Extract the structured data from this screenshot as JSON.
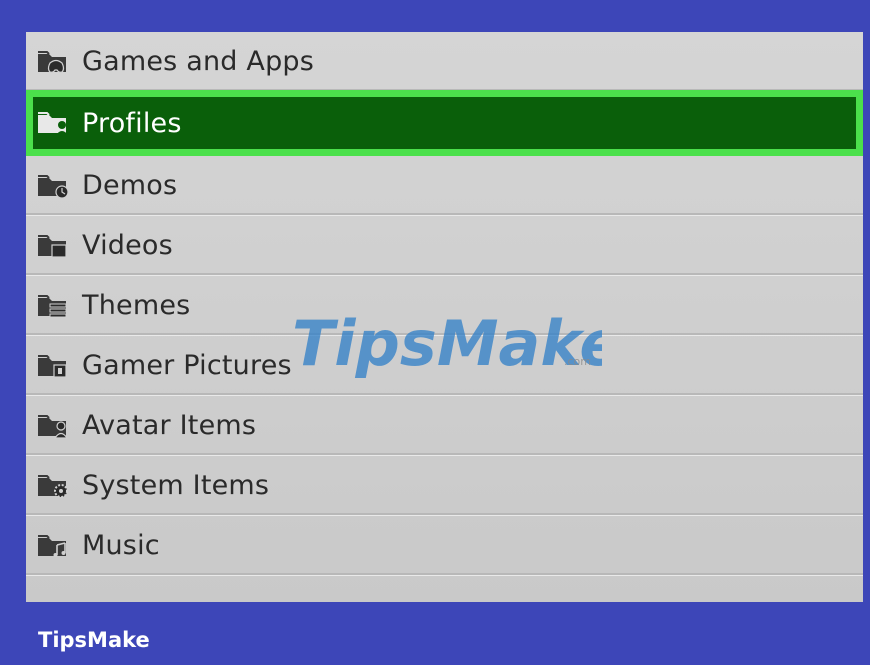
{
  "menu": {
    "items": [
      {
        "label": "Games and Apps",
        "icon": "folder-gamepad-icon",
        "selected": false
      },
      {
        "label": "Profiles",
        "icon": "folder-profile-icon",
        "selected": true
      },
      {
        "label": "Demos",
        "icon": "folder-demo-icon",
        "selected": false
      },
      {
        "label": "Videos",
        "icon": "folder-video-icon",
        "selected": false
      },
      {
        "label": "Themes",
        "icon": "folder-theme-icon",
        "selected": false
      },
      {
        "label": "Gamer Pictures",
        "icon": "folder-picture-icon",
        "selected": false
      },
      {
        "label": "Avatar Items",
        "icon": "folder-avatar-icon",
        "selected": false
      },
      {
        "label": "System Items",
        "icon": "folder-gear-icon",
        "selected": false
      },
      {
        "label": "Music",
        "icon": "folder-music-icon",
        "selected": false
      }
    ]
  },
  "watermark": {
    "brand": "TipsMake",
    "suffix": ".com"
  },
  "footer": {
    "brand": "TipsMake"
  },
  "colors": {
    "background": "#3d46b8",
    "panel": "#d0d0d0",
    "selected_fill": "#0a5f0a",
    "selected_border": "#4be04b",
    "watermark_blue": "#2f7fc8",
    "watermark_gray": "#6a6a6a"
  }
}
